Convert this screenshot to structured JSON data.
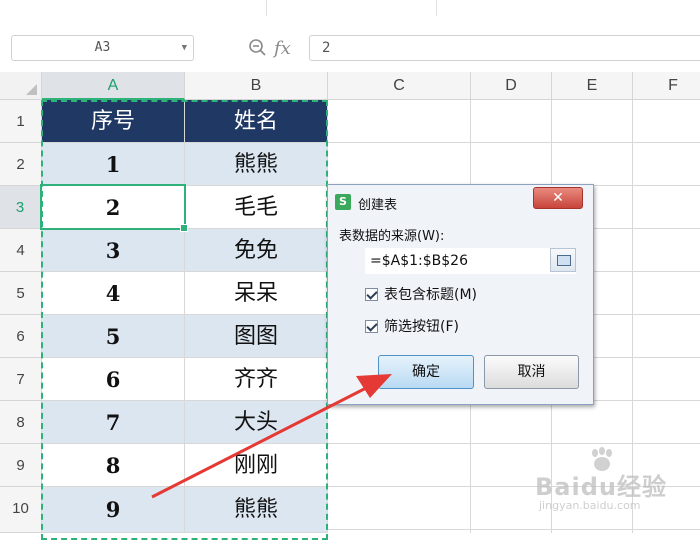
{
  "formula_bar": {
    "name_box": "A3",
    "fx_label": "fx",
    "formula_value": "2"
  },
  "columns": [
    "A",
    "B",
    "C",
    "D",
    "E",
    "F"
  ],
  "rows": [
    "1",
    "2",
    "3",
    "4",
    "5",
    "6",
    "7",
    "8",
    "9",
    "10"
  ],
  "table": {
    "headers": [
      "序号",
      "姓名"
    ],
    "data": [
      [
        "1",
        "熊熊"
      ],
      [
        "2",
        "毛毛"
      ],
      [
        "3",
        "免免"
      ],
      [
        "4",
        "呆呆"
      ],
      [
        "5",
        "图图"
      ],
      [
        "6",
        "齐齐"
      ],
      [
        "7",
        "大头"
      ],
      [
        "8",
        "刚刚"
      ],
      [
        "9",
        "熊熊"
      ]
    ]
  },
  "colors": {
    "header_fill": "#1f3864",
    "band_fill": "#dce6f1",
    "selection": "#2fb27a",
    "arrow": "#e53935"
  },
  "dialog": {
    "logo": "S",
    "title": "创建表",
    "close_label": "✕",
    "source_label": "表数据的来源(W):",
    "range_value": "=$A$1:$B$26",
    "has_header_label": "表包含标题(M)",
    "has_header_checked": true,
    "filter_label": "筛选按钮(F)",
    "filter_checked": true,
    "ok_label": "确定",
    "cancel_label": "取消"
  },
  "watermark": {
    "main": "Baidu经验",
    "sub": "jingyan.baidu.com"
  }
}
